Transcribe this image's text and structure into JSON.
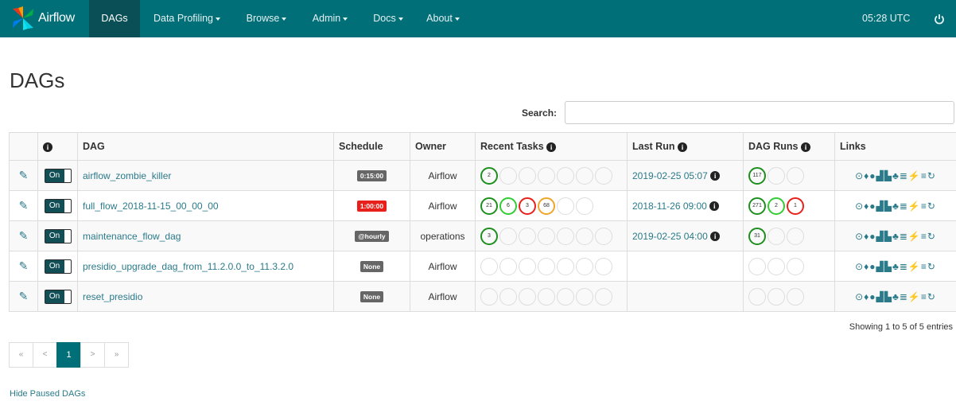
{
  "navbar": {
    "brand": "Airflow",
    "items": [
      {
        "label": "DAGs",
        "caret": false
      },
      {
        "label": "Data Profiling",
        "caret": true
      },
      {
        "label": "Browse",
        "caret": true
      },
      {
        "label": "Admin",
        "caret": true
      },
      {
        "label": "Docs",
        "caret": true
      },
      {
        "label": "About",
        "caret": true
      }
    ],
    "time": "05:28 UTC"
  },
  "page_title": "DAGs",
  "search": {
    "label": "Search:",
    "value": "",
    "placeholder": ""
  },
  "table": {
    "headers": {
      "info": "i",
      "dag": "DAG",
      "schedule": "Schedule",
      "owner": "Owner",
      "recent_tasks": "Recent Tasks",
      "last_run": "Last Run",
      "dag_runs": "DAG Runs",
      "links": "Links"
    },
    "rows": [
      {
        "toggle": "On",
        "dag": "airflow_zombie_killer",
        "schedule": "0:15:00",
        "schedule_color": "gray",
        "owner": "Airflow",
        "recent_tasks": [
          {
            "v": "2",
            "c": "green"
          },
          {
            "v": "",
            "c": ""
          },
          {
            "v": "",
            "c": ""
          },
          {
            "v": "",
            "c": ""
          },
          {
            "v": "",
            "c": ""
          },
          {
            "v": "",
            "c": ""
          },
          {
            "v": "",
            "c": ""
          }
        ],
        "last_run": "2019-02-25 05:07",
        "dag_runs": [
          {
            "v": "117",
            "c": "green"
          },
          {
            "v": "",
            "c": ""
          },
          {
            "v": "",
            "c": ""
          }
        ]
      },
      {
        "toggle": "On",
        "dag": "full_flow_2018-11-15_00_00_00",
        "schedule": "1:00:00",
        "schedule_color": "red",
        "owner": "Airflow",
        "recent_tasks": [
          {
            "v": "21",
            "c": "green"
          },
          {
            "v": "6",
            "c": "lime"
          },
          {
            "v": "3",
            "c": "red"
          },
          {
            "v": "68",
            "c": "orange"
          },
          {
            "v": "",
            "c": ""
          },
          {
            "v": "",
            "c": ""
          }
        ],
        "last_run": "2018-11-26 09:00",
        "dag_runs": [
          {
            "v": "271",
            "c": "green"
          },
          {
            "v": "2",
            "c": "lime"
          },
          {
            "v": "1",
            "c": "red"
          }
        ]
      },
      {
        "toggle": "On",
        "dag": "maintenance_flow_dag",
        "schedule": "@hourly",
        "schedule_color": "gray",
        "owner": "operations",
        "recent_tasks": [
          {
            "v": "3",
            "c": "green"
          },
          {
            "v": "",
            "c": ""
          },
          {
            "v": "",
            "c": ""
          },
          {
            "v": "",
            "c": ""
          },
          {
            "v": "",
            "c": ""
          },
          {
            "v": "",
            "c": ""
          },
          {
            "v": "",
            "c": ""
          }
        ],
        "last_run": "2019-02-25 04:00",
        "dag_runs": [
          {
            "v": "31",
            "c": "green"
          },
          {
            "v": "",
            "c": ""
          },
          {
            "v": "",
            "c": ""
          }
        ]
      },
      {
        "toggle": "On",
        "dag": "presidio_upgrade_dag_from_11.2.0.0_to_11.3.2.0",
        "schedule": "None",
        "schedule_color": "gray",
        "owner": "Airflow",
        "recent_tasks": [
          {
            "v": "",
            "c": ""
          },
          {
            "v": "",
            "c": ""
          },
          {
            "v": "",
            "c": ""
          },
          {
            "v": "",
            "c": ""
          },
          {
            "v": "",
            "c": ""
          },
          {
            "v": "",
            "c": ""
          },
          {
            "v": "",
            "c": ""
          }
        ],
        "last_run": "",
        "dag_runs": [
          {
            "v": "",
            "c": ""
          },
          {
            "v": "",
            "c": ""
          },
          {
            "v": "",
            "c": ""
          }
        ]
      },
      {
        "toggle": "On",
        "dag": "reset_presidio",
        "schedule": "None",
        "schedule_color": "gray",
        "owner": "Airflow",
        "recent_tasks": [
          {
            "v": "",
            "c": ""
          },
          {
            "v": "",
            "c": ""
          },
          {
            "v": "",
            "c": ""
          },
          {
            "v": "",
            "c": ""
          },
          {
            "v": "",
            "c": ""
          },
          {
            "v": "",
            "c": ""
          },
          {
            "v": "",
            "c": ""
          }
        ],
        "last_run": "",
        "dag_runs": [
          {
            "v": "",
            "c": ""
          },
          {
            "v": "",
            "c": ""
          },
          {
            "v": "",
            "c": ""
          }
        ]
      }
    ],
    "links_glyphs": "⊙♦●▟▙♣≣⚡≡↻"
  },
  "footer": {
    "showing": "Showing 1 to 5 of 5 entries",
    "pager": [
      "«",
      "<",
      "1",
      ">",
      "»"
    ],
    "pager_active": 2,
    "hide_paused": "Hide Paused DAGs"
  },
  "colors": {
    "navbar": "#006f78",
    "accent": "#2a7a8a"
  }
}
